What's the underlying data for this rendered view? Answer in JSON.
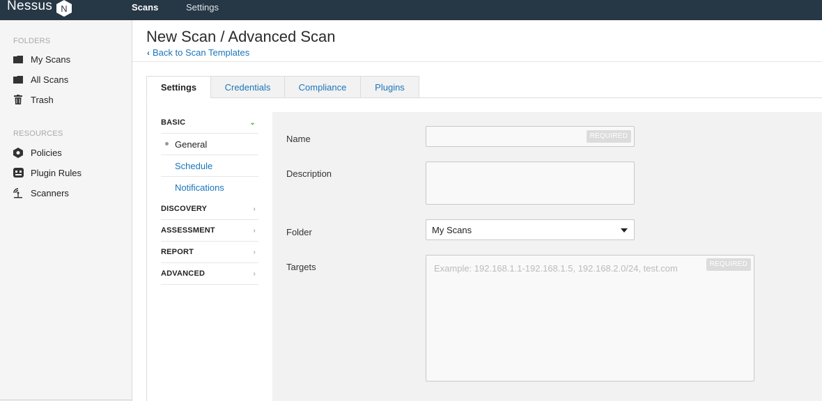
{
  "app": {
    "logo_text": "Nessus",
    "logo_letter": "N"
  },
  "topnav": {
    "items": [
      {
        "label": "Scans",
        "active": true
      },
      {
        "label": "Settings",
        "active": false
      }
    ]
  },
  "sidebar": {
    "folders_label": "FOLDERS",
    "folders": [
      {
        "label": "My Scans",
        "icon": "folder-icon"
      },
      {
        "label": "All Scans",
        "icon": "folder-icon"
      },
      {
        "label": "Trash",
        "icon": "trash-icon"
      }
    ],
    "resources_label": "RESOURCES",
    "resources": [
      {
        "label": "Policies",
        "icon": "shield-icon"
      },
      {
        "label": "Plugin Rules",
        "icon": "plugin-rules-icon"
      },
      {
        "label": "Scanners",
        "icon": "scanner-icon"
      }
    ]
  },
  "header": {
    "title": "New Scan / Advanced Scan",
    "back_link": "Back to Scan Templates"
  },
  "tabs": [
    {
      "label": "Settings",
      "active": true
    },
    {
      "label": "Credentials"
    },
    {
      "label": "Compliance"
    },
    {
      "label": "Plugins"
    }
  ],
  "settings_nav": {
    "basic": "BASIC",
    "basic_items": [
      {
        "label": "General",
        "current": true
      },
      {
        "label": "Schedule"
      },
      {
        "label": "Notifications"
      }
    ],
    "sections": [
      "DISCOVERY",
      "ASSESSMENT",
      "REPORT",
      "ADVANCED"
    ]
  },
  "form": {
    "name_label": "Name",
    "name_value": "",
    "required_badge": "REQUIRED",
    "description_label": "Description",
    "description_value": "",
    "folder_label": "Folder",
    "folder_value": "My Scans",
    "targets_label": "Targets",
    "targets_placeholder": "Example: 192.168.1.1-192.168.1.5, 192.168.2.0/24, test.com"
  },
  "colors": {
    "topbar": "#263746",
    "link": "#1a75bb",
    "accent_green": "#45a843"
  }
}
